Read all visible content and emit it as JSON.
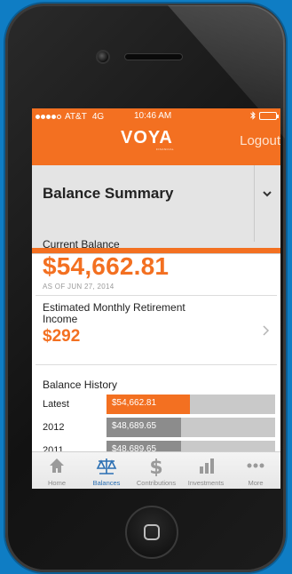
{
  "status_bar": {
    "carrier": "AT&T",
    "network": "4G",
    "time": "10:46 AM"
  },
  "header": {
    "logo": "VOYA",
    "logo_sub": "FINANCIAL",
    "logout_label": "Logout",
    "bg_color": "#f37021"
  },
  "summary": {
    "title": "Balance Summary"
  },
  "current_balance": {
    "label": "Current Balance",
    "amount": "$54,662.81",
    "as_of": "AS OF JUN 27, 2014"
  },
  "estimate": {
    "label": "Estimated Monthly Retirement Income",
    "amount": "$292"
  },
  "history": {
    "title": "Balance History",
    "rows": [
      {
        "year": "Latest",
        "value": "$54,662.81",
        "amount": 54662.81,
        "color": "#f37021"
      },
      {
        "year": "2012",
        "value": "$48,689.65",
        "amount": 48689.65,
        "color": "#8c8c8c"
      },
      {
        "year": "2011",
        "value": "$48,689.65",
        "amount": 48689.65,
        "color": "#8c8c8c"
      }
    ],
    "max": 100000
  },
  "tabs": [
    {
      "label": "Home",
      "icon": "home-icon",
      "active": false
    },
    {
      "label": "Balances",
      "icon": "scale-icon",
      "active": true
    },
    {
      "label": "Contributions",
      "icon": "dollar-icon",
      "active": false
    },
    {
      "label": "Investments",
      "icon": "bar-chart-icon",
      "active": false
    },
    {
      "label": "More",
      "icon": "more-dots-icon",
      "active": false
    }
  ]
}
